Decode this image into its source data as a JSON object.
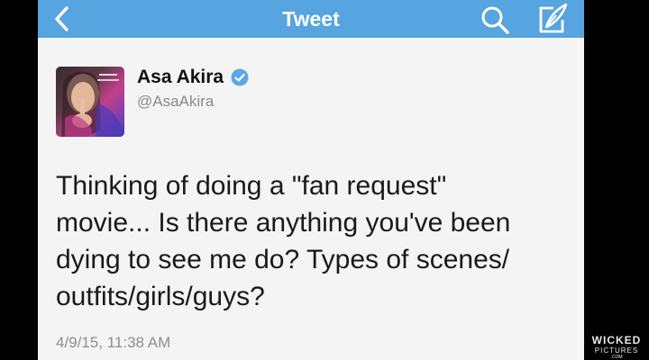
{
  "navbar": {
    "title": "Tweet",
    "color": "#56a4e0",
    "back_icon": "chevron-left-icon",
    "search_icon": "search-icon",
    "compose_icon": "compose-icon"
  },
  "tweet": {
    "author_name": "Asa Akira",
    "verified": true,
    "handle": "@AsaAkira",
    "text_lines": [
      "Thinking of doing a \"fan request\"",
      "movie... Is there anything you've been",
      "dying to see me do? Types of scenes/",
      "outfits/girls/guys?"
    ],
    "timestamp": "4/9/15, 11:38 AM"
  },
  "watermark": {
    "line1": "WICKED",
    "line2": "PICTURES",
    "line3": ".COM"
  }
}
